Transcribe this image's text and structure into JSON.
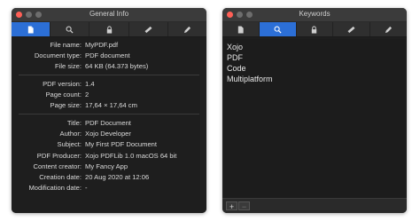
{
  "general_window": {
    "title": "General Info",
    "toolbar": [
      {
        "icon": "document-icon",
        "active": true
      },
      {
        "icon": "search-icon",
        "active": false
      },
      {
        "icon": "lock-icon",
        "active": false
      },
      {
        "icon": "ruler-icon",
        "active": false
      },
      {
        "icon": "pencil-icon",
        "active": false
      }
    ],
    "group1": [
      {
        "label": "File name:",
        "value": "MyPDF.pdf"
      },
      {
        "label": "Document type:",
        "value": "PDF document"
      },
      {
        "label": "File size:",
        "value": "64 KB (64.373 bytes)"
      }
    ],
    "group2": [
      {
        "label": "PDF version:",
        "value": "1.4"
      },
      {
        "label": "Page count:",
        "value": "2"
      },
      {
        "label": "Page size:",
        "value": "17,64 × 17,64 cm"
      }
    ],
    "group3": [
      {
        "label": "Title:",
        "value": "PDF Document"
      },
      {
        "label": "Author:",
        "value": "Xojo Developer"
      },
      {
        "label": "Subject:",
        "value": "My First PDF Document"
      },
      {
        "label": "PDF Producer:",
        "value": "Xojo PDFLib 1.0 macOS 64 bit"
      },
      {
        "label": "Content creator:",
        "value": "My Fancy App"
      },
      {
        "label": "Creation date:",
        "value": "20 Aug 2020 at 12:06"
      },
      {
        "label": "Modification date:",
        "value": "-"
      }
    ]
  },
  "keywords_window": {
    "title": "Keywords",
    "toolbar": [
      {
        "icon": "document-icon",
        "active": false
      },
      {
        "icon": "search-icon",
        "active": true
      },
      {
        "icon": "lock-icon",
        "active": false
      },
      {
        "icon": "ruler-icon",
        "active": false
      },
      {
        "icon": "pencil-icon",
        "active": false
      }
    ],
    "keywords": [
      "Xojo",
      "PDF",
      "Code",
      "Multiplatform"
    ],
    "add_label": "+",
    "remove_label": "−"
  },
  "colors": {
    "accent": "#2c6fd6",
    "close_button": "#ff5f56",
    "window_bg": "#1e1e1e"
  }
}
